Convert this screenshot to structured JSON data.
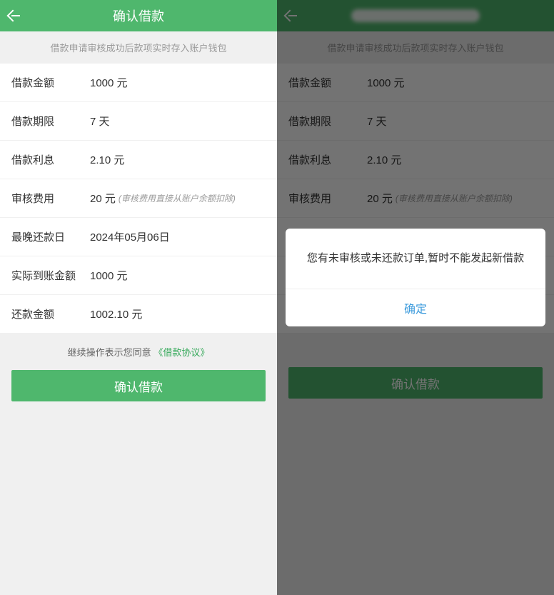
{
  "left": {
    "header_title": "确认借款",
    "notice": "借款申请审核成功后款项实时存入账户钱包",
    "rows": {
      "amount_label": "借款金额",
      "amount_value": "1000 元",
      "period_label": "借款期限",
      "period_value": "7 天",
      "interest_label": "借款利息",
      "interest_value": "2.10 元",
      "fee_label": "审核费用",
      "fee_value": "20 元",
      "fee_hint": "(审核费用直接从账户余额扣除)",
      "due_label": "最晚还款日",
      "due_value": "2024年05月06日",
      "actual_label": "实际到账金额",
      "actual_value": "1000 元",
      "repay_label": "还款金额",
      "repay_value": "1002.10 元"
    },
    "agree_prefix": "继续操作表示您同意",
    "agree_link": "《借款协议》",
    "confirm_btn": "确认借款"
  },
  "right": {
    "notice": "借款申请审核成功后款项实时存入账户钱包",
    "rows": {
      "amount_label": "借款金额",
      "amount_value": "1000 元",
      "period_label": "借款期限",
      "period_value": "7 天",
      "interest_label": "借款利息",
      "interest_value": "2.10 元",
      "fee_label": "审核费用",
      "fee_value": "20 元",
      "fee_hint": "(审核费用直接从账户余额扣除)"
    },
    "confirm_btn": "确认借款",
    "dialog_message": "您有未审核或未还款订单,暂时不能发起新借款",
    "dialog_ok": "确定"
  }
}
